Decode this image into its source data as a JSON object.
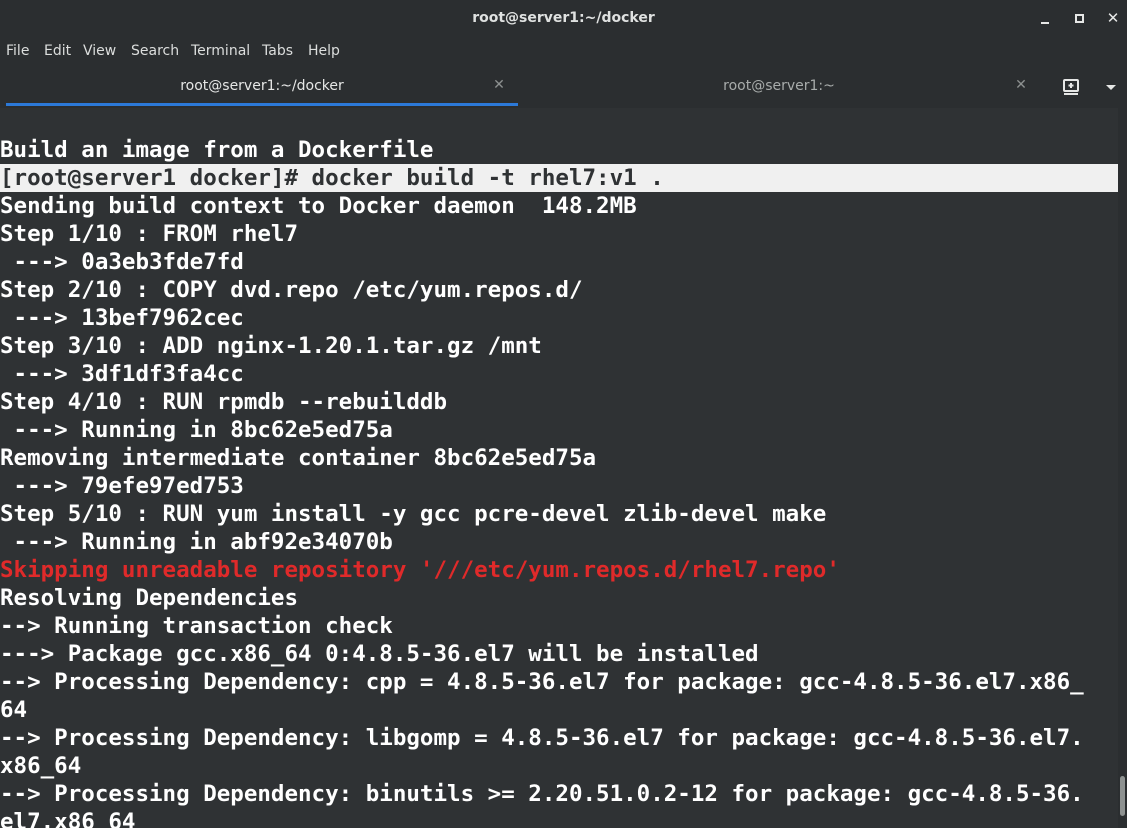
{
  "window": {
    "title": "root@server1:~/docker"
  },
  "menu": {
    "items": [
      "File",
      "Edit",
      "View",
      "Search",
      "Terminal",
      "Tabs",
      "Help"
    ]
  },
  "tabs": [
    {
      "label": "root@server1:~/docker",
      "active": true
    },
    {
      "label": "root@server1:~",
      "active": false
    }
  ],
  "terminal": {
    "lines": [
      "Build an image from a Dockerfile",
      "[root@server1 docker]# docker build -t rhel7:v1 .",
      "Sending build context to Docker daemon  148.2MB",
      "Step 1/10 : FROM rhel7",
      " ---> 0a3eb3fde7fd",
      "Step 2/10 : COPY dvd.repo /etc/yum.repos.d/",
      " ---> 13bef7962cec",
      "Step 3/10 : ADD nginx-1.20.1.tar.gz /mnt",
      " ---> 3df1df3fa4cc",
      "Step 4/10 : RUN rpmdb --rebuilddb",
      " ---> Running in 8bc62e5ed75a",
      "Removing intermediate container 8bc62e5ed75a",
      " ---> 79efe97ed753",
      "Step 5/10 : RUN yum install -y gcc pcre-devel zlib-devel make",
      " ---> Running in abf92e34070b",
      "Skipping unreadable repository '///etc/yum.repos.d/rhel7.repo'",
      "Resolving Dependencies",
      "--> Running transaction check",
      "---> Package gcc.x86_64 0:4.8.5-36.el7 will be installed",
      "--> Processing Dependency: cpp = 4.8.5-36.el7 for package: gcc-4.8.5-36.el7.x86_",
      "64",
      "--> Processing Dependency: libgomp = 4.8.5-36.el7 for package: gcc-4.8.5-36.el7.",
      "x86_64",
      "--> Processing Dependency: binutils >= 2.20.51.0.2-12 for package: gcc-4.8.5-36.",
      "el7.x86_64"
    ],
    "highlighted_line": 1,
    "error_line": 15
  },
  "colors": {
    "background": "#2f3234",
    "text": "#ffffff",
    "error": "#e02a2a",
    "highlight": "#f0f0f0",
    "tab_accent": "#2c79d8"
  },
  "icons": {
    "minimize": "minimize-icon",
    "maximize": "maximize-icon",
    "close": "close-icon",
    "new_tab": "new-tab-icon",
    "tab_menu": "chevron-down-icon"
  }
}
